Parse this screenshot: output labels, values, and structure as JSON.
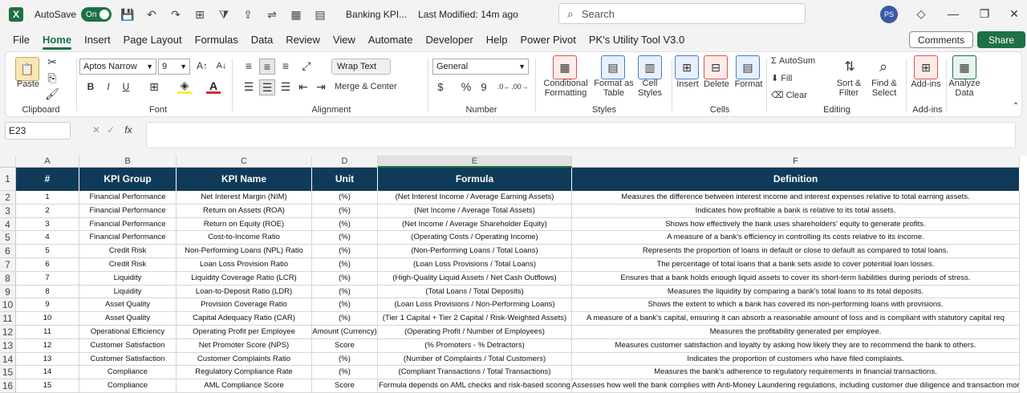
{
  "titlebar": {
    "app_badge": "X",
    "autosave_label": "AutoSave",
    "autosave_state": "On",
    "doc_title": "Banking KPI...",
    "last_modified": "Last Modified: 14m ago",
    "search_placeholder": "Search",
    "user_initials": "PS"
  },
  "menu": {
    "items": [
      "File",
      "Home",
      "Insert",
      "Page Layout",
      "Formulas",
      "Data",
      "Review",
      "View",
      "Automate",
      "Developer",
      "Help",
      "Power Pivot",
      "PK's Utility Tool V3.0"
    ],
    "active": "Home",
    "comments": "Comments",
    "share": "Share"
  },
  "ribbon": {
    "clipboard": {
      "label": "Clipboard",
      "paste": "Paste"
    },
    "font": {
      "label": "Font",
      "name": "Aptos Narrow",
      "size": "9",
      "bold": "B",
      "italic": "I",
      "underline": "U"
    },
    "alignment": {
      "label": "Alignment",
      "wrap": "Wrap Text",
      "merge": "Merge & Center"
    },
    "number": {
      "label": "Number",
      "format": "General",
      "currency": "$",
      "percent": "%",
      "comma": "9"
    },
    "styles": {
      "label": "Styles",
      "conditional_1": "Conditional",
      "conditional_2": "Formatting",
      "table_1": "Format as",
      "table_2": "Table",
      "cell_1": "Cell",
      "cell_2": "Styles"
    },
    "cells": {
      "label": "Cells",
      "insert": "Insert",
      "delete": "Delete",
      "format": "Format"
    },
    "editing": {
      "label": "Editing",
      "autosum": "AutoSum",
      "fill": "Fill",
      "clear": "Clear",
      "sort_1": "Sort &",
      "sort_2": "Filter",
      "find_1": "Find &",
      "find_2": "Select"
    },
    "addins": {
      "label": "Add-ins",
      "addins": "Add-ins",
      "analyze_1": "Analyze",
      "analyze_2": "Data"
    }
  },
  "formulabar": {
    "namebox": "E23",
    "fx": "fx"
  },
  "sheet": {
    "columns": [
      "A",
      "B",
      "C",
      "D",
      "E",
      "F"
    ],
    "selected_column": "E",
    "headers": [
      "#",
      "KPI Group",
      "KPI Name",
      "Unit",
      "Formula",
      "Definition"
    ],
    "rows": [
      [
        "1",
        "Financial Performance",
        "Net Interest Margin (NIM)",
        "(%)",
        "(Net Interest Income / Average Earning Assets)",
        "Measures the difference between interest income and interest expenses relative to total earning assets."
      ],
      [
        "2",
        "Financial Performance",
        "Return on Assets (ROA)",
        "(%)",
        "(Net Income / Average Total Assets)",
        "Indicates how profitable a bank is relative to its total assets."
      ],
      [
        "3",
        "Financial Performance",
        "Return on Equity (ROE)",
        "(%)",
        "(Net Income / Average Shareholder Equity)",
        "Shows how effectively the bank uses shareholders' equity to generate profits."
      ],
      [
        "4",
        "Financial Performance",
        "Cost-to-Income Ratio",
        "(%)",
        "(Operating Costs / Operating Income)",
        "A measure of a bank's efficiency in controlling its costs relative to its income."
      ],
      [
        "5",
        "Credit Risk",
        "Non-Performing Loans (NPL) Ratio",
        "(%)",
        "(Non-Performing Loans / Total Loans)",
        "Represents the proportion of loans in default or close to default as compared to total loans."
      ],
      [
        "6",
        "Credit Risk",
        "Loan Loss Provision Ratio",
        "(%)",
        "(Loan Loss Provisions / Total Loans)",
        "The percentage of total loans that a bank sets aside to cover potential loan losses."
      ],
      [
        "7",
        "Liquidity",
        "Liquidity Coverage Ratio (LCR)",
        "(%)",
        "(High-Quality Liquid Assets / Net Cash Outflows)",
        "Ensures that a bank holds enough liquid assets to cover its short-term liabilities during periods of stress."
      ],
      [
        "8",
        "Liquidity",
        "Loan-to-Deposit Ratio (LDR)",
        "(%)",
        "(Total Loans / Total Deposits)",
        "Measures the liquidity by comparing a bank's total loans to its total deposits."
      ],
      [
        "9",
        "Asset Quality",
        "Provision Coverage Ratio",
        "(%)",
        "(Loan Loss Provisions / Non-Performing Loans)",
        "Shows the extent to which a bank has covered its non-performing loans with provisions."
      ],
      [
        "10",
        "Asset Quality",
        "Capital Adequacy Ratio (CAR)",
        "(%)",
        "(Tier 1 Capital + Tier 2 Capital / Risk-Weighted Assets)",
        "A measure of a bank's capital, ensuring it can absorb a reasonable amount of loss and is compliant with statutory capital req"
      ],
      [
        "11",
        "Operational Efficiency",
        "Operating Profit per Employee",
        "Amount (Currency)",
        "(Operating Profit / Number of Employees)",
        "Measures the profitability generated per employee."
      ],
      [
        "12",
        "Customer Satisfaction",
        "Net Promoter Score (NPS)",
        "Score",
        "(% Promoters - % Detractors)",
        "Measures customer satisfaction and loyalty by asking how likely they are to recommend the bank to others."
      ],
      [
        "13",
        "Customer Satisfaction",
        "Customer Complaints Ratio",
        "(%)",
        "(Number of Complaints / Total Customers)",
        "Indicates the proportion of customers who have filed complaints."
      ],
      [
        "14",
        "Compliance",
        "Regulatory Compliance Rate",
        "(%)",
        "(Compliant Transactions / Total Transactions)",
        "Measures the bank's adherence to regulatory requirements in financial transactions."
      ],
      [
        "15",
        "Compliance",
        "AML Compliance Score",
        "Score",
        "Formula depends on AML checks and risk-based scoring",
        "Assesses how well the bank complies with Anti-Money Laundering regulations, including customer due diligence and transaction mor"
      ]
    ]
  }
}
